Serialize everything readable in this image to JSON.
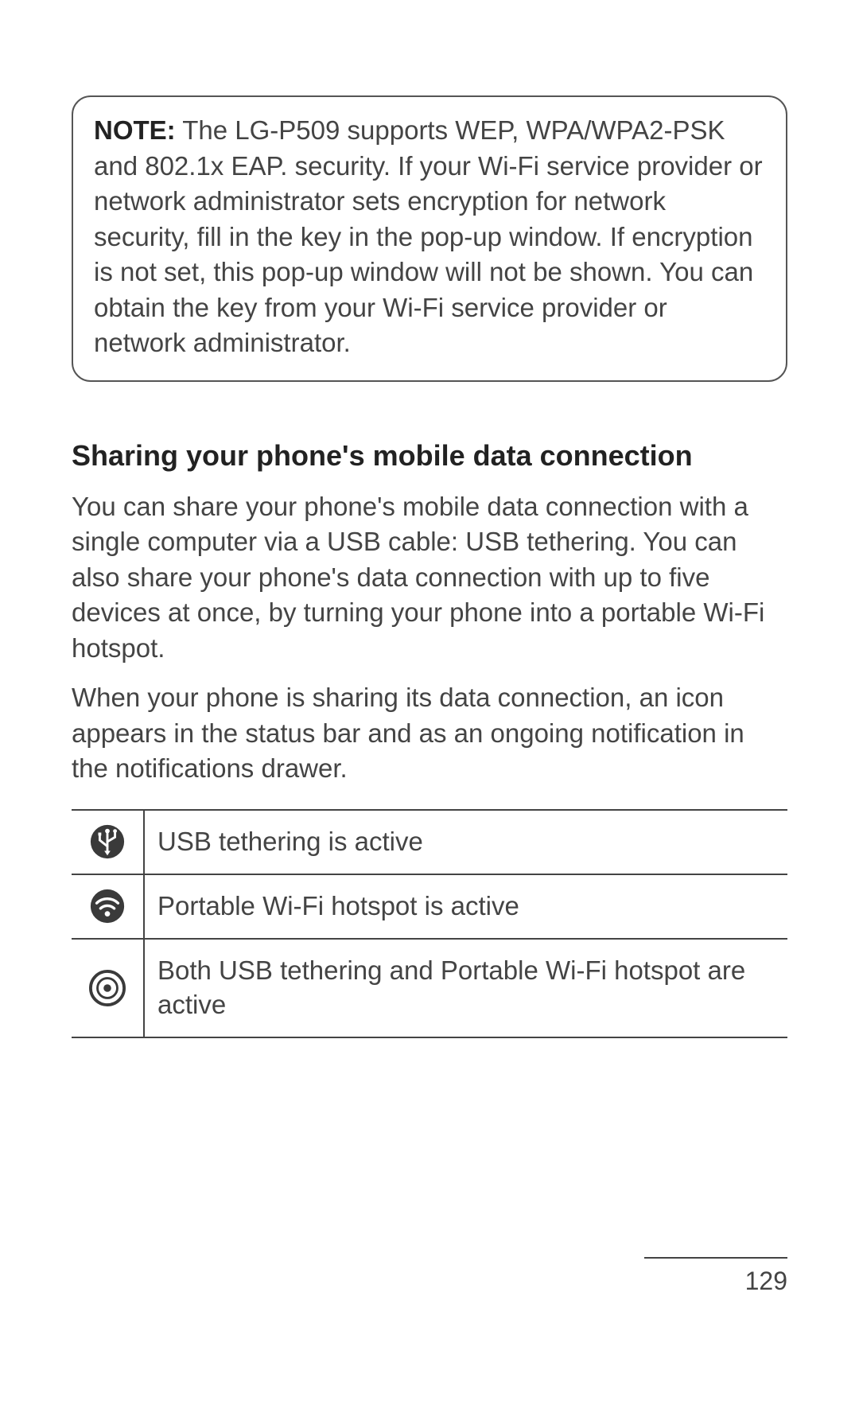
{
  "note": {
    "label": "NOTE:",
    "text": " The LG-P509 supports WEP, WPA/WPA2-PSK and 802.1x EAP. security. If your Wi-Fi service provider or network administrator sets encryption for network security, fill in the key in the pop-up window. If encryption is not set, this pop-up window will not be shown. You can obtain the key from your Wi-Fi service provider or network administrator."
  },
  "section": {
    "heading": "Sharing your phone's mobile data connection",
    "para1": "You can share your phone's mobile data connection with a single computer via a USB cable: USB tethering. You can also share your phone's data connection with up to five devices at once, by turning your phone into a portable Wi-Fi hotspot.",
    "para2": "When your phone is sharing its data connection, an icon appears in the status bar and as an ongoing notification in the notifications drawer."
  },
  "icons": {
    "rows": [
      {
        "name": "usb-tethering-icon",
        "desc": "USB tethering is active"
      },
      {
        "name": "wifi-hotspot-icon",
        "desc": "Portable Wi-Fi hotspot is active"
      },
      {
        "name": "both-active-icon",
        "desc": "Both USB tethering and Portable Wi-Fi hotspot are active"
      }
    ]
  },
  "page_number": "129"
}
